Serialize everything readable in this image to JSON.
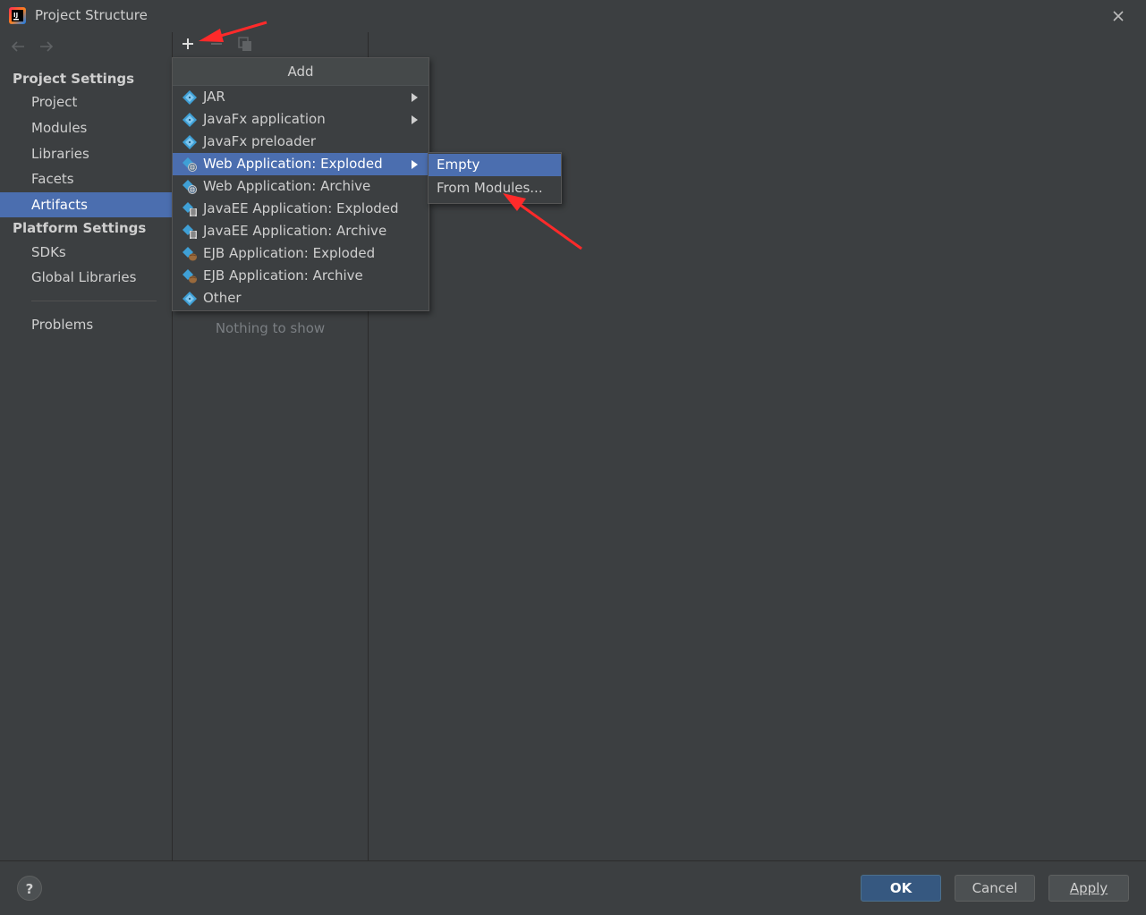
{
  "window": {
    "title": "Project Structure"
  },
  "sidebar": {
    "project_settings_heading": "Project Settings",
    "items": [
      {
        "label": "Project"
      },
      {
        "label": "Modules"
      },
      {
        "label": "Libraries"
      },
      {
        "label": "Facets"
      },
      {
        "label": "Artifacts",
        "selected": true
      }
    ],
    "platform_settings_heading": "Platform Settings",
    "platform_items": [
      {
        "label": "SDKs"
      },
      {
        "label": "Global Libraries"
      }
    ],
    "problems_label": "Problems"
  },
  "middle": {
    "empty_text": "Nothing to show"
  },
  "add_menu": {
    "header": "Add",
    "items": [
      {
        "label": "JAR",
        "icon": "artifact-diamond-icon",
        "has_submenu": true
      },
      {
        "label": "JavaFx application",
        "icon": "artifact-diamond-icon",
        "has_submenu": true
      },
      {
        "label": "JavaFx preloader",
        "icon": "artifact-diamond-icon",
        "has_submenu": false
      },
      {
        "label": "Web Application: Exploded",
        "icon": "web-artifact-icon",
        "has_submenu": true,
        "active": true
      },
      {
        "label": "Web Application: Archive",
        "icon": "web-artifact-icon",
        "has_submenu": false
      },
      {
        "label": "JavaEE Application: Exploded",
        "icon": "javaee-artifact-icon",
        "has_submenu": false
      },
      {
        "label": "JavaEE Application: Archive",
        "icon": "javaee-artifact-icon",
        "has_submenu": false
      },
      {
        "label": "EJB Application: Exploded",
        "icon": "ejb-artifact-icon",
        "has_submenu": false
      },
      {
        "label": "EJB Application: Archive",
        "icon": "ejb-artifact-icon",
        "has_submenu": false
      },
      {
        "label": "Other",
        "icon": "artifact-diamond-icon",
        "has_submenu": false
      }
    ]
  },
  "submenu": {
    "items": [
      {
        "label": "Empty",
        "active": true
      },
      {
        "label": "From Modules..."
      }
    ]
  },
  "buttons": {
    "help": "?",
    "ok": "OK",
    "cancel": "Cancel",
    "apply": "Apply"
  },
  "colors": {
    "background": "#3c3f41",
    "selection": "#4b6eaf",
    "primary_button": "#365880",
    "annotation_arrow": "#ff2a2a"
  }
}
